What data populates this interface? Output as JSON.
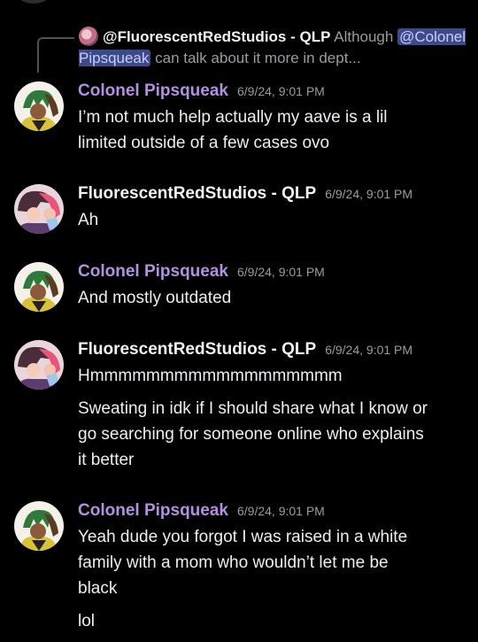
{
  "reply": {
    "author": "@FluorescentRedStudios - QLP",
    "text_before": "Although",
    "mention": "@Colonel Pipsqueak",
    "text_after": "can talk about it more in dept..."
  },
  "messages": [
    {
      "author": "Colonel Pipsqueak",
      "timestamp": "6/9/24, 9:01 PM",
      "lines": [
        "I’m not much help actually my aave is a lil",
        "limited outside of a few cases ovo"
      ]
    },
    {
      "author": "FluorescentRedStudios - QLP",
      "timestamp": "6/9/24, 9:01 PM",
      "lines": [
        "Ah"
      ]
    },
    {
      "author": "Colonel Pipsqueak",
      "timestamp": "6/9/24, 9:01 PM",
      "lines": [
        "And mostly outdated"
      ]
    },
    {
      "author": "FluorescentRedStudios - QLP",
      "timestamp": "6/9/24, 9:01 PM",
      "lines": [
        "Hmmmmmmmmmmmmmmmmmm"
      ],
      "lines2": [
        "Sweating in idk if I should share what I know or",
        "go searching for someone online who explains",
        "it better"
      ]
    },
    {
      "author": "Colonel Pipsqueak",
      "timestamp": "6/9/24, 9:01 PM",
      "lines": [
        "Yeah dude you forgot I was raised in a white",
        "family with a mom who wouldn’t let me be",
        "black"
      ],
      "lines2": [
        "lol"
      ]
    }
  ],
  "colors": {
    "background": "#000000",
    "author_purple": "#b390e0",
    "author_white": "#f2f3f5",
    "mention_bg": "#3d4a8a",
    "timestamp": "#9a9ca3"
  },
  "icons": {
    "avatar_colonel": "avatar-colonel-pipsqueak",
    "avatar_fluorescent": "avatar-fluorescentredstudios"
  }
}
